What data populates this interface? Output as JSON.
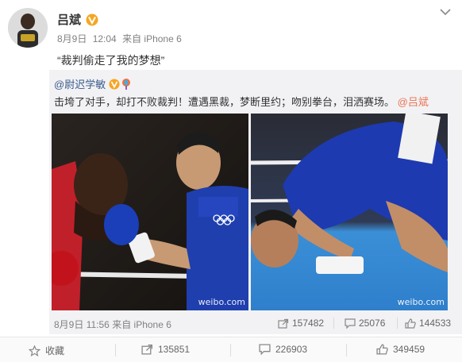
{
  "post": {
    "author": "吕斌",
    "meta": {
      "date": "8月9日",
      "time": "12:04",
      "source": "来自 iPhone 6"
    },
    "text": "“裁判偷走了我的梦想”"
  },
  "repost": {
    "author": "@尉迟学敏",
    "text": "击垮了对手，却打不败裁判！遭遇黑裁，梦断里约；吻别拳台，泪洒赛场。",
    "mention": "@吕斌",
    "watermark": "weibo.com",
    "footer": {
      "date": "8月9日",
      "time": "11:56",
      "source": "来自 iPhone 6",
      "forwards": "157482",
      "comments": "25076",
      "likes": "144533"
    }
  },
  "actions": {
    "favorite": "收藏",
    "forward_count": "135851",
    "comment_count": "226903",
    "like_count": "349459"
  },
  "colors": {
    "link": "#3a5b8b",
    "mention": "#eb7350",
    "badge": "#f5a623",
    "repost_bg": "#f2f2f5"
  },
  "icons": [
    "verified-badge-icon",
    "chevron-down-icon",
    "forward-icon",
    "comment-icon",
    "like-icon",
    "star-icon"
  ]
}
